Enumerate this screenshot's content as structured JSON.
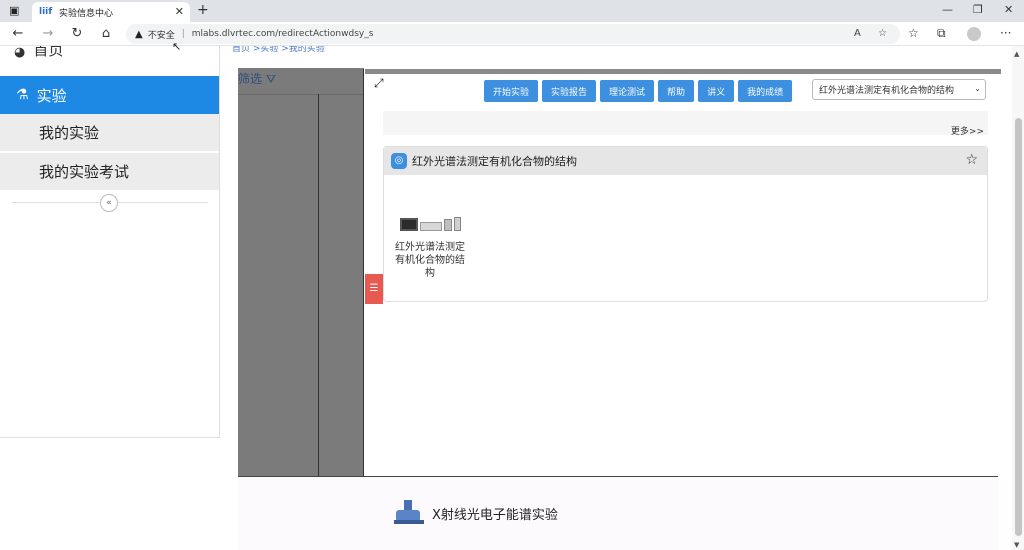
{
  "browser": {
    "tab_title": "实验信息中心",
    "favicon_text": "liif",
    "new_tab": "+",
    "security_label": "不安全",
    "url": "mlabs.dlvrtec.com/redirectActionwdsy_s"
  },
  "sidebar": {
    "home_label": "首页",
    "experiment_label": "实验",
    "items": [
      {
        "label": "我的实验"
      },
      {
        "label": "我的实验考试"
      }
    ]
  },
  "breadcrumb": "首页 >实验 >我的实验",
  "filter": {
    "label": "筛选"
  },
  "toolbar": {
    "buttons": [
      {
        "label": "开始实验"
      },
      {
        "label": "实验报告"
      },
      {
        "label": "理论测试"
      },
      {
        "label": "帮助"
      },
      {
        "label": "讲义"
      },
      {
        "label": "我的成绩"
      }
    ],
    "selected_experiment": "红外光谱法测定有机化合物的结构"
  },
  "more_link": "更多>>",
  "card": {
    "title": "红外光谱法测定有机化合物的结构",
    "item_label": "红外光谱法测定有机化合物的结构"
  },
  "lower": {
    "item_label": "X射线光电子能谱实验"
  },
  "colors": {
    "accent": "#1e88e5",
    "button": "#3d8fe0",
    "side_tab": "#e85a4f",
    "filter_column": "#7b7b7b"
  }
}
